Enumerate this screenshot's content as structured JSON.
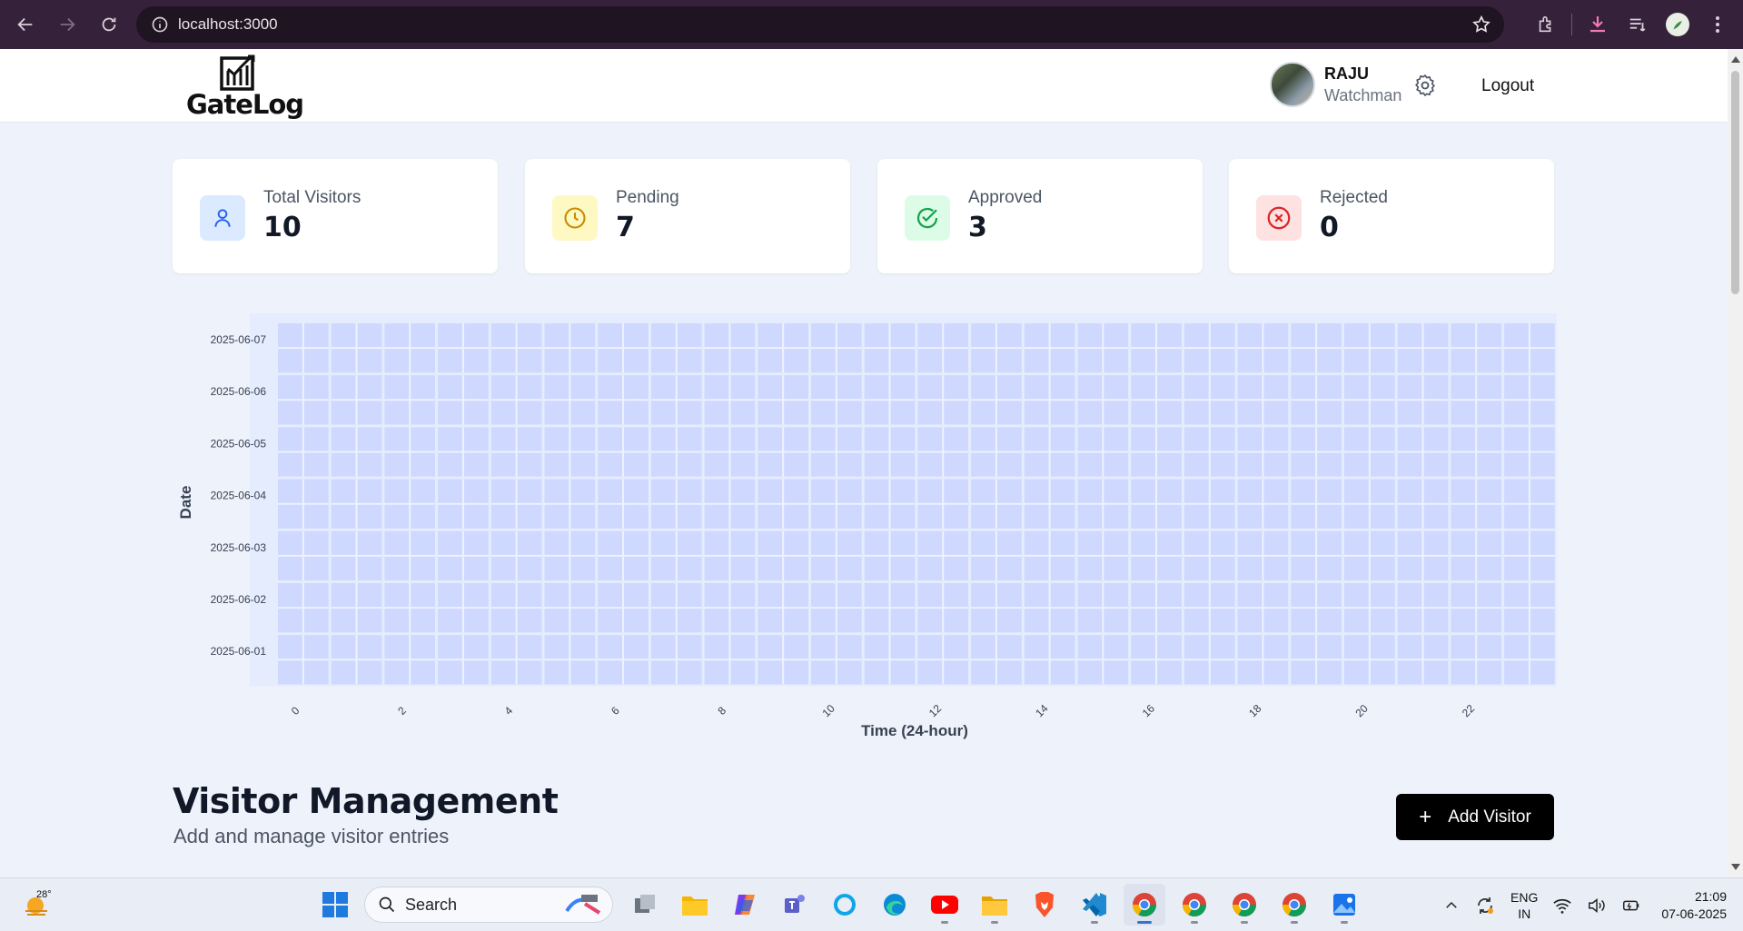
{
  "browser": {
    "url": "localhost:3000"
  },
  "header": {
    "logo_text": "GateLog",
    "user_name": "RAJU",
    "user_role": "Watchman",
    "logout_label": "Logout"
  },
  "stats": [
    {
      "label": "Total Visitors",
      "value": "10",
      "icon": "user-icon",
      "bg": "#dbeafe",
      "fg": "#2563eb"
    },
    {
      "label": "Pending",
      "value": "7",
      "icon": "clock-icon",
      "bg": "#fef9c3",
      "fg": "#ca8a04"
    },
    {
      "label": "Approved",
      "value": "3",
      "icon": "check-circle-icon",
      "bg": "#dcfce7",
      "fg": "#16a34a"
    },
    {
      "label": "Rejected",
      "value": "0",
      "icon": "x-circle-icon",
      "bg": "#fee2e2",
      "fg": "#dc2626"
    }
  ],
  "chart_data": {
    "type": "heatmap",
    "xlabel": "Time (24-hour)",
    "ylabel": "Date",
    "x": [
      0,
      1,
      2,
      3,
      4,
      5,
      6,
      7,
      8,
      9,
      10,
      11,
      12,
      13,
      14,
      15,
      16,
      17,
      18,
      19,
      20,
      21,
      22,
      23
    ],
    "x_tick_labels": [
      "0",
      "2",
      "4",
      "6",
      "8",
      "10",
      "12",
      "14",
      "16",
      "18",
      "20",
      "22"
    ],
    "y": [
      "2025-06-01",
      "2025-06-02",
      "2025-06-03",
      "2025-06-04",
      "2025-06-05",
      "2025-06-06",
      "2025-06-07"
    ],
    "cell_color": "#c7d2fe"
  },
  "visitor_management": {
    "title": "Visitor Management",
    "subtitle": "Add and manage visitor entries",
    "add_button_label": "Add Visitor"
  },
  "taskbar": {
    "temperature": "28°",
    "search_label": "Search",
    "lang_line1": "ENG",
    "lang_line2": "IN",
    "time": "21:09",
    "date": "07-06-2025"
  }
}
